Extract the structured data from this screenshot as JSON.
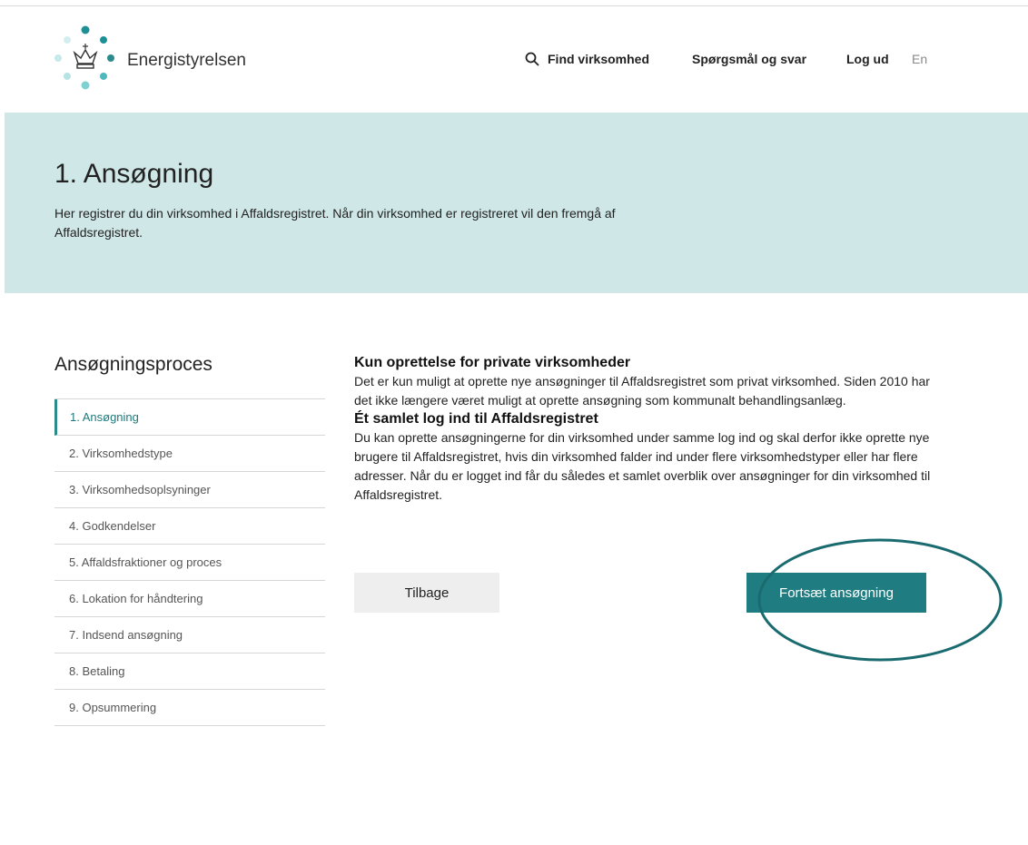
{
  "header": {
    "logo_text": "Energistyrelsen",
    "nav": {
      "search_label": "Find virksomhed",
      "faq_label": "Spørgsmål og svar",
      "logout_label": "Log ud",
      "lang_label": "En"
    }
  },
  "hero": {
    "title": "1. Ansøgning",
    "text": "Her registrer du din virksomhed i Affaldsregistret. Når din virksomhed er registreret vil den fremgå af Affaldsregistret."
  },
  "sidebar": {
    "title": "Ansøgningsproces",
    "items": [
      {
        "label": "1. Ansøgning"
      },
      {
        "label": "2. Virksomhedstype"
      },
      {
        "label": "3. Virksomhedsoplsyninger"
      },
      {
        "label": "4. Godkendelser"
      },
      {
        "label": "5. Affaldsfraktioner og proces"
      },
      {
        "label": "6. Lokation for håndtering"
      },
      {
        "label": "7. Indsend ansøgning"
      },
      {
        "label": "8. Betaling"
      },
      {
        "label": "9. Opsummering"
      }
    ]
  },
  "main": {
    "section1": {
      "heading": "Kun oprettelse for private virksomheder",
      "text": "Det er kun muligt at oprette nye ansøgninger til Affaldsregistret som privat virksomhed. Siden 2010 har det ikke længere været muligt at oprette ansøgning som kommunalt behandlingsanlæg."
    },
    "section2": {
      "heading": "Ét samlet log ind til Affaldsregistret",
      "text": "Du kan oprette ansøgningerne for din virksomhed under samme log ind og skal derfor ikke oprette nye brugere til Affaldsregistret, hvis din virksomhed falder ind under flere virksomhedstyper eller har flere adresser. Når du er logget ind får du således et samlet overblik over ansøgninger for din virksomhed til Affaldsregistret."
    },
    "back_label": "Tilbage",
    "continue_label": "Fortsæt ansøgning"
  },
  "colors": {
    "accent": "#1f7d82",
    "hero_bg": "#cfe7e7",
    "ring": "#1a6b6f"
  }
}
